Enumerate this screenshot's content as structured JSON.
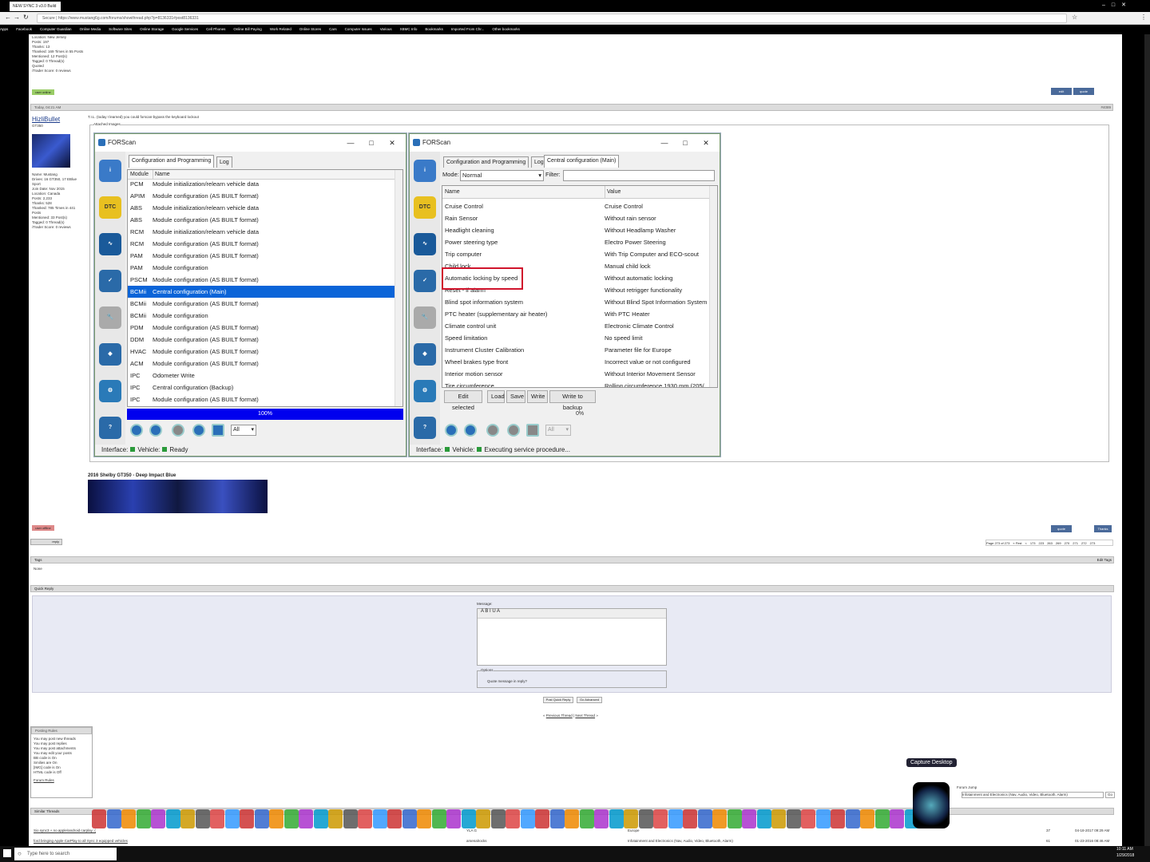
{
  "browser": {
    "tab_title": "NEW SYNC 3 v3.0 Build",
    "url": "https://www.mustang6g.com/forums/showthread.php?p=8136331#post8136331",
    "secure_label": "Secure",
    "bookmarks": [
      "Apps",
      "Facebook",
      "Computer Guardian",
      "Online Media",
      "Software Sites",
      "Online Storage",
      "Google Services",
      "Cell Phones",
      "Online Bill Paying",
      "Work Related",
      "Online Stores",
      "Cars",
      "Computer Issues",
      "Various",
      "XBMC Info",
      "Bookmarks",
      "Imported From Chr...",
      "Other bookmarks"
    ]
  },
  "prev_post": {
    "user_info": [
      "Location: New Jersey",
      "Posts: 197",
      "Thanks: 13",
      "Thanked: 169 Times in 55 Posts",
      "Mentioned: 12 Post(s)",
      "Tagged: 0 Thread(s)",
      "Quoted",
      "iTrader Score: 0 reviews"
    ],
    "status": "user online",
    "btn_edit": "edit",
    "btn_quote": "quote"
  },
  "post": {
    "date": "Today, 04:21 AM",
    "number": "#4089",
    "username": "HizliBullet",
    "user_title": "GT350",
    "user_info": [
      "Name: Mustang",
      "Drives: 16 GT350, 17 EBlue",
      "Sport",
      "Join Date: Nov 2015",
      "Location: Canada",
      "Posts: 2,233",
      "Thanks: 528",
      "Thanked: 785 Times in 441",
      "Posts",
      "Mentioned: 33 Post(s)",
      "Tagged: 0 Thread(s)",
      "iTrader Score: 0 reviews"
    ],
    "text": "T.I.L. (today I learned) you could forscan-bypass the keyboard lockout",
    "attached_label": "Attached Images",
    "signature": "2016 Shelby GT350 - Deep Impact Blue",
    "status": "user offline",
    "btn_quote": "quote",
    "btn_thanks": "Thanks"
  },
  "forscan_left": {
    "title": "FORScan",
    "tabs": [
      "Configuration and Programming",
      "Log"
    ],
    "col_module": "Module",
    "col_name": "Name",
    "rows": [
      [
        "PCM",
        "Module initialization/relearn vehicle data"
      ],
      [
        "APIM",
        "Module configuration (AS BUILT format)"
      ],
      [
        "ABS",
        "Module initialization/relearn vehicle data"
      ],
      [
        "ABS",
        "Module configuration (AS BUILT format)"
      ],
      [
        "RCM",
        "Module initialization/relearn vehicle data"
      ],
      [
        "RCM",
        "Module configuration (AS BUILT format)"
      ],
      [
        "PAM",
        "Module configuration (AS BUILT format)"
      ],
      [
        "PAM",
        "Module configuration"
      ],
      [
        "PSCM",
        "Module configuration (AS BUILT format)"
      ],
      [
        "BCMii",
        "Central configuration (Main)"
      ],
      [
        "BCMii",
        "Module configuration (AS BUILT format)"
      ],
      [
        "BCMii",
        "Module configuration"
      ],
      [
        "PDM",
        "Module configuration (AS BUILT format)"
      ],
      [
        "DDM",
        "Module configuration (AS BUILT format)"
      ],
      [
        "HVAC",
        "Module configuration (AS BUILT format)"
      ],
      [
        "ACM",
        "Module configuration (AS BUILT format)"
      ],
      [
        "IPC",
        "Odometer Write"
      ],
      [
        "IPC",
        "Central configuration (Backup)"
      ],
      [
        "IPC",
        "Module configuration (AS BUILT format)"
      ]
    ],
    "selected_index": 9,
    "progress_label": "100%",
    "progress": 1.0,
    "filter_value": "All",
    "status_interface": "Interface:",
    "status_vehicle": "Vehicle:",
    "status_text": "Ready"
  },
  "forscan_right": {
    "title": "FORScan",
    "tabs": [
      "Configuration and Programming",
      "Log",
      "Central configuration (Main)"
    ],
    "mode_label": "Mode:",
    "mode_value": "Normal",
    "filter_label": "Filter:",
    "col_name": "Name",
    "col_value": "Value",
    "rows": [
      [
        "Cruise Control",
        "Cruise Control"
      ],
      [
        "Rain Sensor",
        "Without rain sensor"
      ],
      [
        "Headlight cleaning",
        "Without Headlamp Washer"
      ],
      [
        "Power steering type",
        "Electro Power Steering"
      ],
      [
        "Trip computer",
        "With Trip Computer and ECO-scout"
      ],
      [
        "Child lock",
        "Manual child lock"
      ],
      [
        "Automatic locking by speed",
        "Without automatic locking"
      ],
      [
        "Reset - if alarm",
        "Without retrigger functionality"
      ],
      [
        "Blind spot information system",
        "Without Blind Spot Information System"
      ],
      [
        "PTC heater (supplementary air heater)",
        "With PTC Heater"
      ],
      [
        "Climate control unit",
        "Electronic Climate Control"
      ],
      [
        "Speed limitation",
        "No speed limit"
      ],
      [
        "Instrument Cluster Calibration",
        "Parameter file for Europe"
      ],
      [
        "Wheel brakes type front",
        "Incorrect value or not configured"
      ],
      [
        "Interior motion sensor",
        "Without Interior Movement Sensor"
      ],
      [
        "Tire circumference",
        "Rolling circumference 1930 mm (205/"
      ]
    ],
    "highlight_index": 6,
    "buttons": [
      "Edit selected",
      "Load",
      "Save",
      "Write",
      "Write to backup"
    ],
    "progress_label": "0%",
    "progress": 0.0,
    "filter_value": "All",
    "status_interface": "Interface:",
    "status_vehicle": "Vehicle:",
    "status_text": "Executing service procedure..."
  },
  "lower": {
    "reply_btn": "reply",
    "pagination": [
      "Page 273 of 273",
      "« First",
      "<",
      "173",
      "223",
      "263",
      "269",
      "270",
      "271",
      "272",
      "273"
    ],
    "tags_header": "Tags",
    "tags_value": "None",
    "edit_tags": "Edit Tags",
    "quick_reply": "Quick Reply",
    "message_label": "Message:",
    "options_label": "Options",
    "quote_option": "Quote message in reply?",
    "btn_post": "Post Quick Reply",
    "btn_advanced": "Go Advanced",
    "prev_thread": "Previous Thread",
    "next_thread": "Next Thread",
    "posting_rules_title": "Posting Rules",
    "posting_rules": [
      "You may post new threads",
      "You may post replies",
      "You may post attachments",
      "You may edit your posts"
    ],
    "codes": [
      "BB code is On",
      "Smilies are On",
      "[IMG] code is On",
      "HTML code is Off"
    ],
    "forum_rules": "Forum Rules",
    "forum_jump": "Forum Jump",
    "forum_jump_value": "Infotainment and Electronics (Nav, Audio, Video, Bluetooth, Alarm)",
    "go": "Go",
    "similar_threads": "Similar Threads",
    "similar": [
      [
        "Sio sync3 + no apple/android carplay :(",
        "YLA G",
        "Europe",
        "37",
        "04-18-2017 09:29 AM"
      ],
      [
        "ford bringing Apple CarPlay to all Sync 3 equipped vehicles",
        "arsenalrocks",
        "Infotainment and Electronics (Nav, Audio, Video, Bluetooth, Alarm)",
        "61",
        "01-23-2016 08:46 AM"
      ]
    ]
  },
  "dock": {
    "tooltip": "Capture Desktop"
  },
  "taskbar": {
    "search_placeholder": "Type here to search",
    "time": "10:11 AM",
    "date": "1/29/2018"
  },
  "colors": {
    "accent": "#0a64d8",
    "forscan_border": "#7a9c6e",
    "highlight": "#d0142c",
    "progress_fill": "#0000ee"
  }
}
